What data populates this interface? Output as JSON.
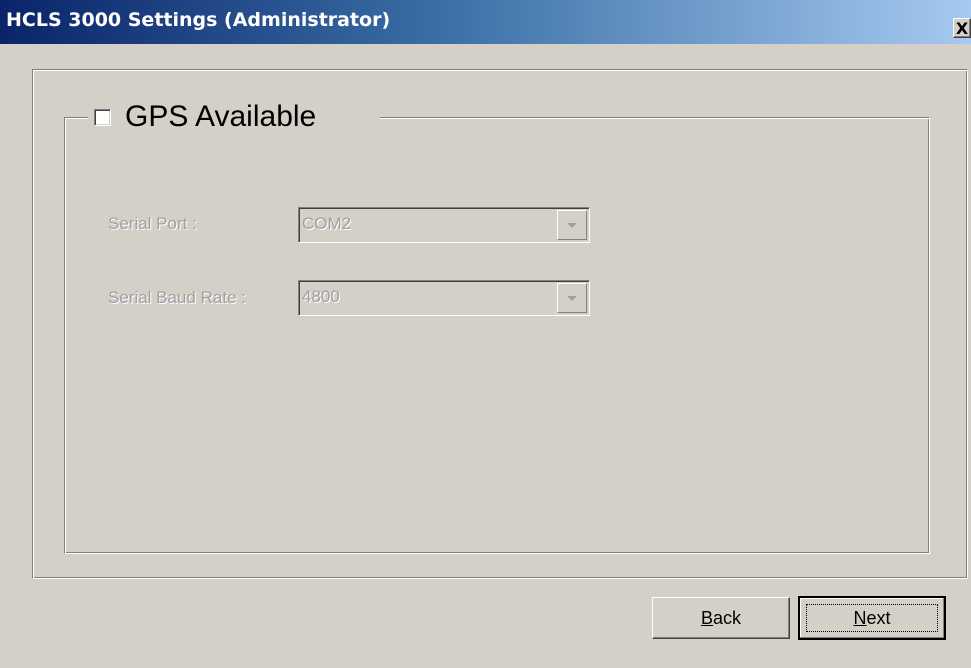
{
  "window": {
    "title": "HCLS 3000 Settings (Administrator)",
    "close_glyph": "X"
  },
  "gps": {
    "label": "GPS Available",
    "checked": false
  },
  "form": {
    "serial_port": {
      "label": "Serial Port :",
      "value": "COM2",
      "enabled": false
    },
    "baud_rate": {
      "label": "Serial Baud Rate :",
      "value": "4800",
      "enabled": false
    }
  },
  "buttons": {
    "back": {
      "accel": "B",
      "rest": "ack"
    },
    "next": {
      "accel": "N",
      "rest": "ext"
    }
  },
  "colors": {
    "titlebar_start": "#0a246a",
    "titlebar_end": "#a6caf0",
    "dialog_bg": "#d4d0c8",
    "disabled_text": "#a0a0a0"
  },
  "icons": {
    "close": "close-icon",
    "dropdown": "chevron-down-icon",
    "checkbox": "checkbox-unchecked"
  }
}
